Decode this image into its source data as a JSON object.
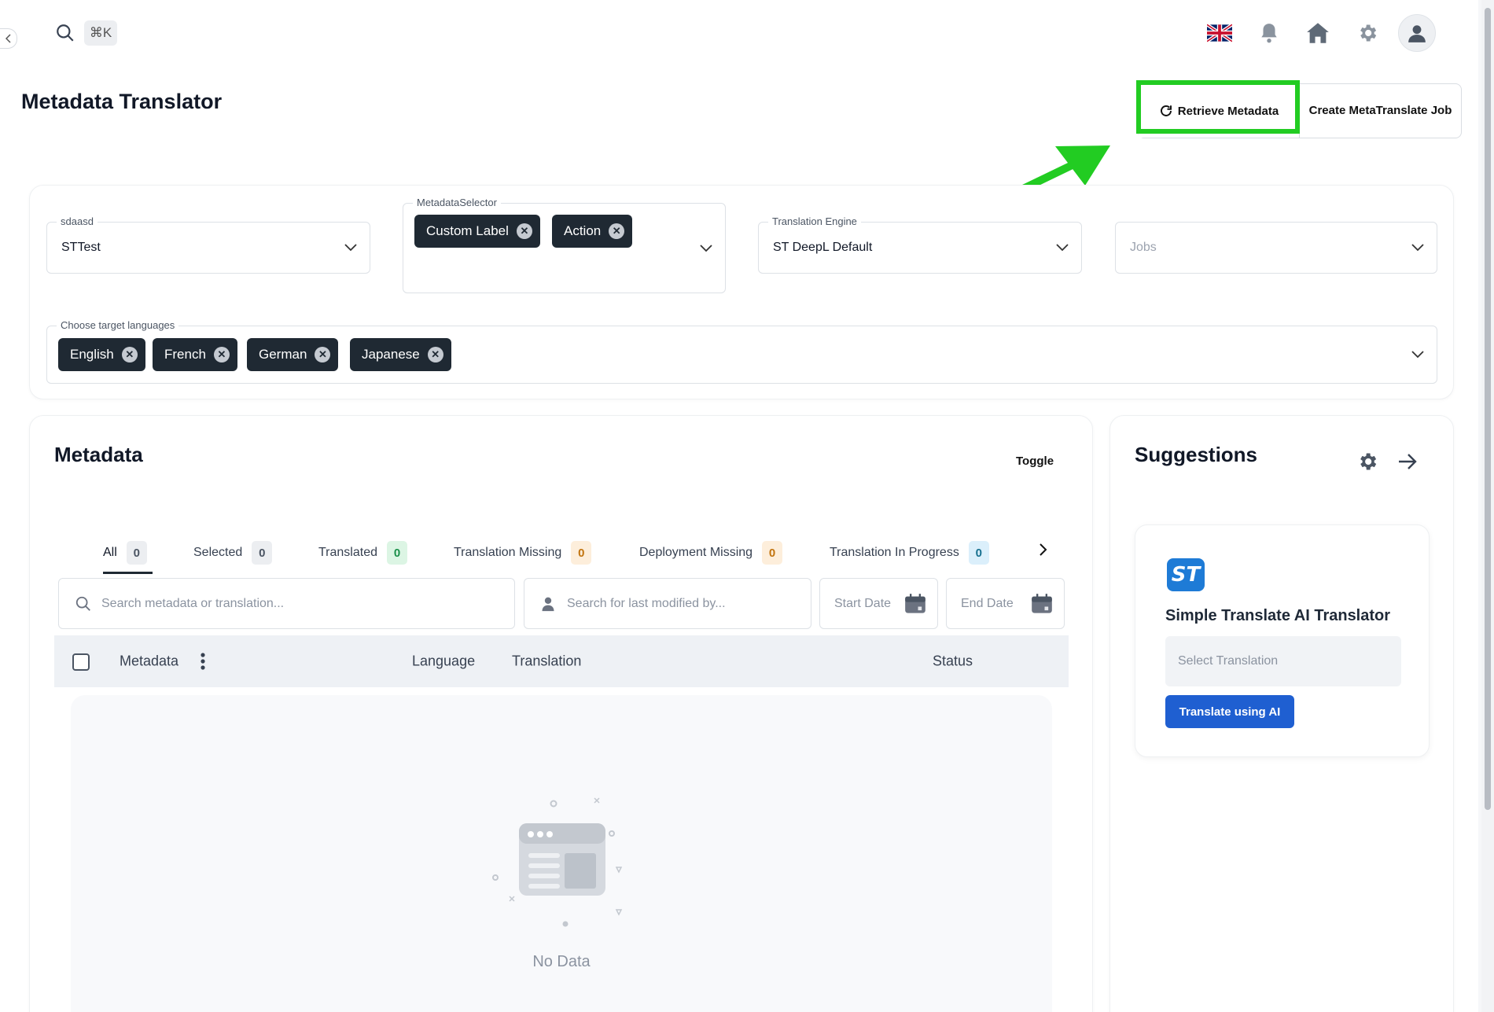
{
  "topbar": {
    "shortcut": "⌘K"
  },
  "page": {
    "title": "Metadata Translator",
    "retrieve_label": "Retrieve Metadata",
    "create_label": "Create MetaTranslate Job"
  },
  "filters": {
    "org": {
      "label": "sdaasd",
      "value": "STTest"
    },
    "metadata_selector": {
      "label": "MetadataSelector",
      "chips": [
        "Custom Label",
        "Action"
      ]
    },
    "engine": {
      "label": "Translation Engine",
      "value": "ST DeepL Default"
    },
    "jobs": {
      "placeholder": "Jobs"
    },
    "languages": {
      "label": "Choose target languages",
      "chips": [
        "English",
        "French",
        "German",
        "Japanese"
      ]
    }
  },
  "metadata": {
    "title": "Metadata",
    "toggle_label": "Toggle",
    "tabs": [
      {
        "label": "All",
        "count": "0"
      },
      {
        "label": "Selected",
        "count": "0"
      },
      {
        "label": "Translated",
        "count": "0"
      },
      {
        "label": "Translation Missing",
        "count": "0"
      },
      {
        "label": "Deployment Missing",
        "count": "0"
      },
      {
        "label": "Translation In Progress",
        "count": "0"
      }
    ],
    "search_placeholder": "Search metadata or translation...",
    "user_search_placeholder": "Search for last modified by...",
    "start_date_placeholder": "Start Date",
    "end_date_placeholder": "End Date",
    "columns": [
      "Metadata",
      "Language",
      "Translation",
      "Status"
    ],
    "empty_text": "No Data"
  },
  "suggestions": {
    "title": "Suggestions",
    "logo_text": "ST",
    "translator_title": "Simple Translate AI Translator",
    "select_placeholder": "Select Translation",
    "translate_button": "Translate using AI"
  },
  "colors": {
    "highlight": "#22cc22",
    "primary_button": "#1f5fd1",
    "chip": "#1f2933"
  }
}
